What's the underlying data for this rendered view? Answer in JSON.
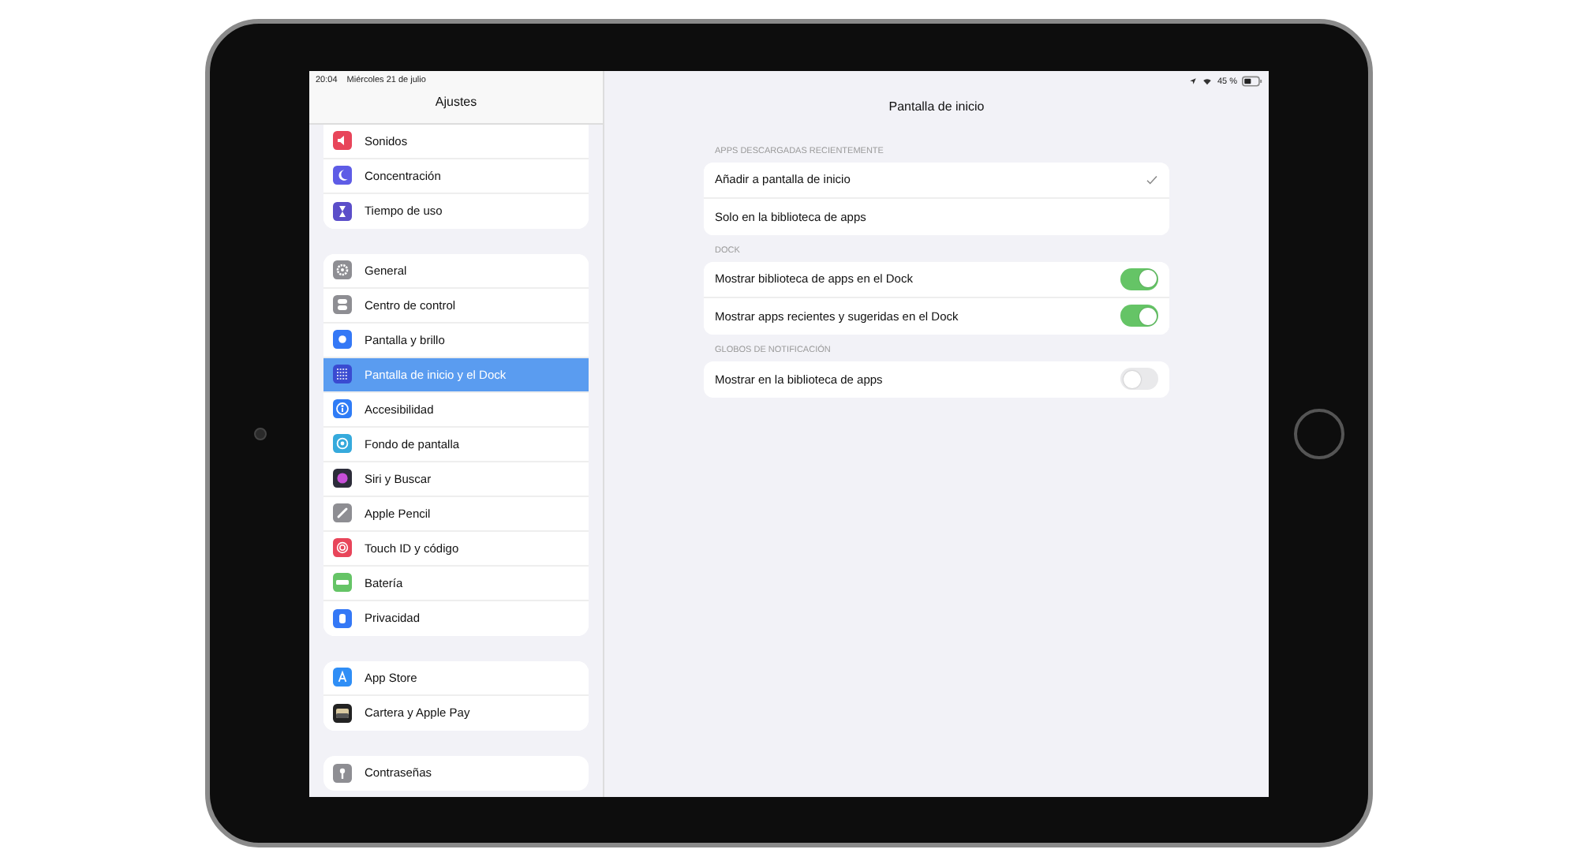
{
  "status_bar": {
    "time": "20:04",
    "date": "Miércoles 21 de julio",
    "battery": "45 %"
  },
  "sidebar": {
    "title": "Ajustes",
    "groups": [
      {
        "items": [
          {
            "label": "Sonidos",
            "kind": "speaker",
            "color": "#e8455a",
            "selected": false
          },
          {
            "label": "Concentración",
            "kind": "moon",
            "color": "#5e5ce6",
            "selected": false
          },
          {
            "label": "Tiempo de uso",
            "kind": "hourglass",
            "color": "#5b4ec9",
            "selected": false
          }
        ]
      },
      {
        "items": [
          {
            "label": "General",
            "kind": "gear",
            "color": "#8e8e93",
            "selected": false
          },
          {
            "label": "Centro de control",
            "kind": "switches",
            "color": "#8e8e93",
            "selected": false
          },
          {
            "label": "Pantalla y brillo",
            "kind": "sun",
            "color": "#3478f6",
            "selected": false
          },
          {
            "label": "Pantalla de inicio y el Dock",
            "kind": "grid",
            "color": "#3a4bd1",
            "selected": true
          },
          {
            "label": "Accesibilidad",
            "kind": "person",
            "color": "#2f7cf6",
            "selected": false
          },
          {
            "label": "Fondo de pantalla",
            "kind": "flower",
            "color": "#36aadc",
            "selected": false
          },
          {
            "label": "Siri y Buscar",
            "kind": "orb",
            "color": "#2c2c3a",
            "selected": false
          },
          {
            "label": "Apple Pencil",
            "kind": "pencil",
            "color": "#8e8e93",
            "selected": false
          },
          {
            "label": "Touch ID y código",
            "kind": "fingerprint",
            "color": "#e8455a",
            "selected": false
          },
          {
            "label": "Batería",
            "kind": "battery",
            "color": "#65c466",
            "selected": false
          },
          {
            "label": "Privacidad",
            "kind": "hand",
            "color": "#3478f6",
            "selected": false
          }
        ]
      },
      {
        "items": [
          {
            "label": "App Store",
            "kind": "letter",
            "color": "#2f8ef6",
            "selected": false
          },
          {
            "label": "Cartera y Apple Pay",
            "kind": "wallet",
            "color": "#222222",
            "selected": false
          }
        ]
      },
      {
        "items": [
          {
            "label": "Contraseñas",
            "kind": "key",
            "color": "#8e8e93",
            "selected": false
          }
        ]
      }
    ]
  },
  "detail": {
    "title": "Pantalla de inicio",
    "sections": [
      {
        "header": "APPS DESCARGADAS RECIENTEMENTE",
        "rows": [
          {
            "kind": "option",
            "label": "Añadir a pantalla de inicio",
            "selected": true
          },
          {
            "kind": "option",
            "label": "Solo en la biblioteca de apps",
            "selected": false
          }
        ]
      },
      {
        "header": "DOCK",
        "rows": [
          {
            "kind": "toggle",
            "label": "Mostrar biblioteca de apps en el Dock",
            "on": true
          },
          {
            "kind": "toggle",
            "label": "Mostrar apps recientes y sugeridas en el Dock",
            "on": true
          }
        ]
      },
      {
        "header": "GLOBOS DE NOTIFICACIÓN",
        "rows": [
          {
            "kind": "toggle",
            "label": "Mostrar en la biblioteca de apps",
            "on": false
          }
        ]
      }
    ]
  }
}
